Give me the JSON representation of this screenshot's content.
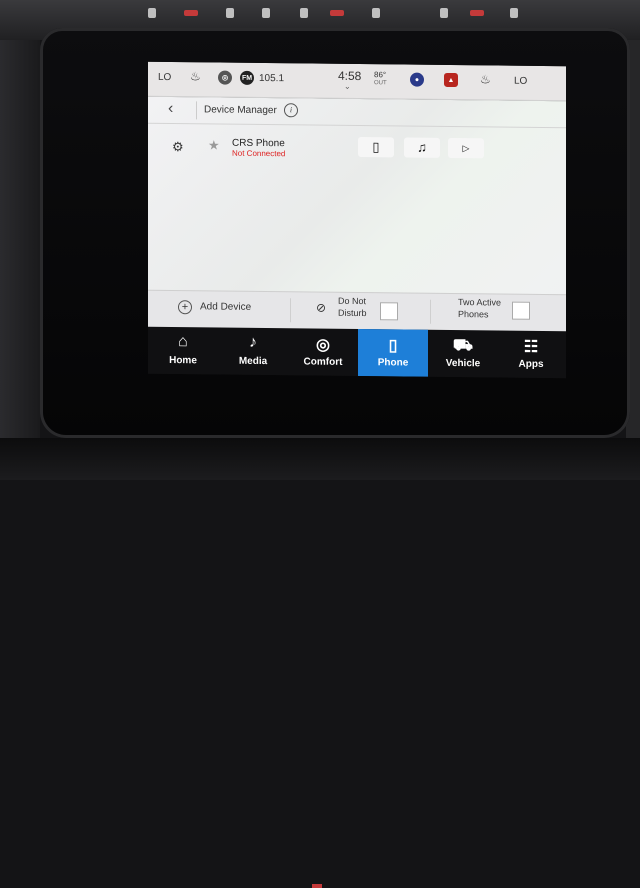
{
  "status_bar": {
    "left_temp": "LO",
    "radio_badge": "FM",
    "radio_freq": "105.1",
    "time": "4:58",
    "outside_temp": "86°",
    "outside_label": "OUT",
    "right_temp": "LO"
  },
  "header": {
    "title": "Device Manager",
    "info": "i"
  },
  "device": {
    "name": "CRS Phone",
    "status": "Not Connected"
  },
  "actions": {
    "add_device": "Add Device",
    "dnd_line1": "Do Not",
    "dnd_line2": "Disturb",
    "two_phones_line1": "Two Active",
    "two_phones_line2": "Phones"
  },
  "nav": [
    {
      "label": "Home",
      "icon": "home-icon"
    },
    {
      "label": "Media",
      "icon": "music-note-icon"
    },
    {
      "label": "Comfort",
      "icon": "comfort-icon"
    },
    {
      "label": "Phone",
      "icon": "phone-icon"
    },
    {
      "label": "Vehicle",
      "icon": "car-icon"
    },
    {
      "label": "Apps",
      "icon": "apps-grid-icon"
    }
  ],
  "colors": {
    "accent": "#1e7fd8",
    "status_error": "#d22222"
  }
}
